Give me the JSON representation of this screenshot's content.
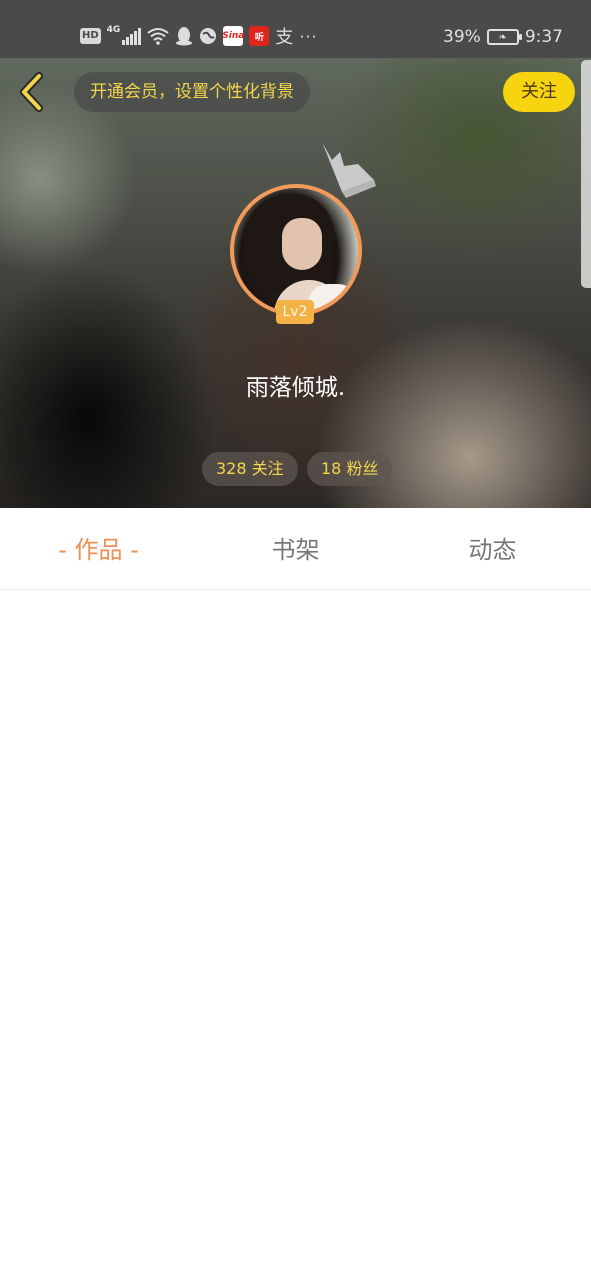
{
  "status_bar": {
    "hd_label": "HD",
    "network_label": "4G",
    "sina_label": "Sina",
    "ting_label": "听",
    "alipay_glyph": "支",
    "more_label": "···",
    "battery_percent": "39%",
    "time": "9:37",
    "icons": [
      "hd-icon",
      "signal-icon",
      "wifi-icon",
      "qq-icon",
      "browser-icon",
      "sina-icon",
      "ting-icon",
      "alipay-icon",
      "more-icon",
      "battery-icon"
    ]
  },
  "header": {
    "back_icon": "chevron-left-icon",
    "vip_prompt": "开通会员，设置个性化背景",
    "follow_label": "关注",
    "level": "Lv2",
    "username": "雨落倾城.",
    "stats": {
      "following": "328 关注",
      "fans": "18 粉丝"
    }
  },
  "tabs": [
    {
      "label": "- 作品 -",
      "active": true
    },
    {
      "label": "书架",
      "active": false
    },
    {
      "label": "动态",
      "active": false
    }
  ],
  "colors": {
    "accent": "#ef8f52",
    "follow_button": "#f6d40f",
    "vip_text": "#f3d64a",
    "level_badge": "#f3b244"
  }
}
